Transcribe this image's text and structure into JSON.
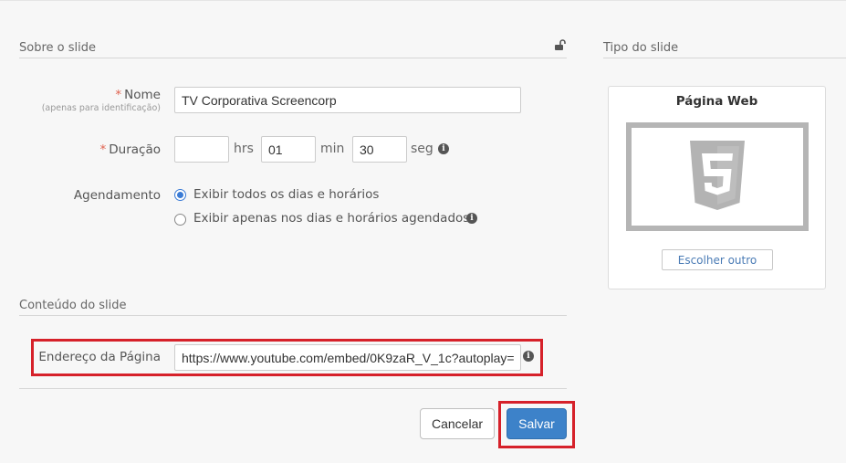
{
  "sections": {
    "about_title": "Sobre o slide",
    "content_title": "Conteúdo do slide",
    "type_title": "Tipo do slide"
  },
  "form": {
    "name": {
      "required_mark": "*",
      "label": "Nome",
      "sublabel": "(apenas para identificação)",
      "value": "TV Corporativa Screencorp"
    },
    "duration": {
      "required_mark": "*",
      "label": "Duração",
      "hours_value": "",
      "hours_unit": "hrs",
      "minutes_value": "01",
      "minutes_unit": "min",
      "seconds_value": "30",
      "seconds_unit": "seg"
    },
    "schedule": {
      "label": "Agendamento",
      "options": [
        {
          "label": "Exibir todos os dias e horários",
          "checked": true
        },
        {
          "label": "Exibir apenas nos dias e horários agendados",
          "checked": false
        }
      ]
    },
    "page_address": {
      "label": "Endereço da Página",
      "value": "https://www.youtube.com/embed/0K9zaR_V_1c?autoplay="
    }
  },
  "actions": {
    "cancel_label": "Cancelar",
    "save_label": "Salvar"
  },
  "slide_type": {
    "title": "Página Web",
    "icon": "html5-icon",
    "change_label": "Escolher outro"
  },
  "icons": {
    "lock": "unlock-icon",
    "info": "info-icon"
  },
  "colors": {
    "accent": "#3d82c9",
    "highlight": "#d6212a",
    "required": "#e0624f"
  }
}
